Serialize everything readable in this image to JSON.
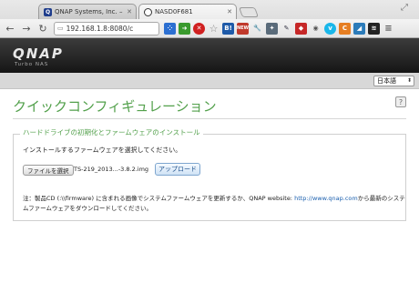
{
  "browser": {
    "tabs": [
      {
        "title": "QNAP Systems, Inc. – Netw",
        "favicon": "Q"
      },
      {
        "title": "NASD0F681",
        "favicon": ""
      }
    ],
    "url": "192.168.1.8:8080/c",
    "extensions": [
      "blue-dots-icon",
      "green-arrow-icon",
      "red-stop-icon",
      "star-icon",
      "hatena-icon",
      "new-badge-icon",
      "wrench-icon",
      "puzzle-icon",
      "pen-icon",
      "red-car-icon",
      "eye-icon",
      "vimeo-icon",
      "c-icon",
      "tweetdeck-icon",
      "layers-icon",
      "menu-icon"
    ]
  },
  "header": {
    "logo": "QNAP",
    "subtitle": "Turbo NAS"
  },
  "language": {
    "selected": "日本語"
  },
  "main": {
    "title": "クイックコンフィギュレーション",
    "section_legend": "ハードドライブの初期化とファームウェアのインストール",
    "instruction": "インストールするファームウェアを選択してください。",
    "file_button": "ファイルを選択",
    "file_name": "TS-219_2013...-3.8.2.img",
    "upload_button": "アップロード",
    "note_prefix": "注：製品CD (:\\\\firmware) に含まれる画像でシステムファームウェアを更新するか、QNAP website: ",
    "note_link": "http://www.qnap.com",
    "note_suffix": "から最新のシステムファームウェアをダウンロードしてください。"
  }
}
